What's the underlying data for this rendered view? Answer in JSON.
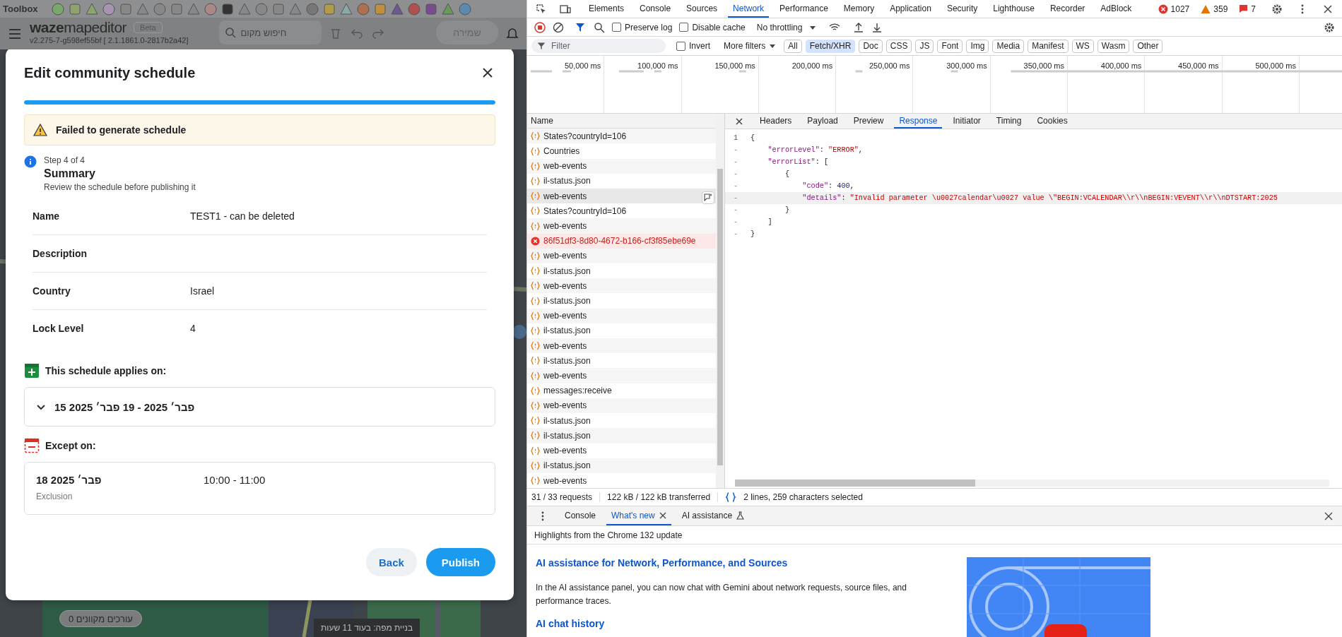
{
  "app": {
    "toolbox_label": "Toolbox",
    "logo_bold": "waze",
    "logo_light": "mapeditor",
    "beta": "Beta",
    "version": "v2.275-7-g598ef55bf [ 2.1.1861.0-2817b2a42]",
    "search": {
      "placeholder": "חיפוש מקום"
    },
    "save_button": "שמירה",
    "online_editors": "עורכים מקוונים 0",
    "map_build": "בניית מפה: בעוד 11 שעות"
  },
  "dialog": {
    "title": "Edit community schedule",
    "progress": {
      "level": 1
    },
    "alert": "Failed to generate schedule",
    "step": {
      "counter": "Step 4 of 4",
      "title": "Summary",
      "description": "Review the schedule before publishing it"
    },
    "fields": [
      {
        "label": "Name",
        "value": "TEST1 - can be deleted"
      },
      {
        "label": "Description"
      },
      {
        "label": "Country",
        "value": "Israel"
      },
      {
        "label": "Lock Level",
        "value": "4"
      }
    ],
    "applies_heading": "This schedule applies on:",
    "applies_range": {
      "text": "פבר׳ 2025 - 19 פבר׳ 2025 15",
      "expanded": false
    },
    "except_heading": "Except on:",
    "exceptions": [
      {
        "date": "פבר׳ 2025 18",
        "type": "Exclusion",
        "time": "10:00 - 11:00"
      }
    ],
    "buttons": [
      {
        "label": "Back",
        "kind": "secondary"
      },
      {
        "label": "Publish",
        "kind": "primary"
      }
    ]
  },
  "devtools": {
    "tabs": [
      {
        "label": "Elements",
        "selected": false
      },
      {
        "label": "Console",
        "selected": false
      },
      {
        "label": "Sources",
        "selected": false
      },
      {
        "label": "Network",
        "selected": true
      },
      {
        "label": "Performance",
        "selected": false
      },
      {
        "label": "Memory",
        "selected": false
      },
      {
        "label": "Application",
        "selected": false
      },
      {
        "label": "Security",
        "selected": false
      },
      {
        "label": "Lighthouse",
        "selected": false
      },
      {
        "label": "Recorder",
        "selected": false
      },
      {
        "label": "AdBlock",
        "selected": false
      }
    ],
    "counts": {
      "errors": "1027",
      "warnings": "359",
      "issues": "7"
    },
    "toolbar": {
      "preserve_log": {
        "label": "Preserve log",
        "checked": false
      },
      "disable_cache": {
        "label": "Disable cache",
        "checked": false
      },
      "throttling": "No throttling"
    },
    "filter": {
      "placeholder": "Filter",
      "invert": {
        "label": "Invert",
        "checked": false
      },
      "more_filters": "More filters",
      "types": [
        {
          "label": "All",
          "selected": false
        },
        {
          "label": "Fetch/XHR",
          "selected": true
        },
        {
          "label": "Doc",
          "selected": false
        },
        {
          "label": "CSS",
          "selected": false
        },
        {
          "label": "JS",
          "selected": false
        },
        {
          "label": "Font",
          "selected": false
        },
        {
          "label": "Img",
          "selected": false
        },
        {
          "label": "Media",
          "selected": false
        },
        {
          "label": "Manifest",
          "selected": false
        },
        {
          "label": "WS",
          "selected": false
        },
        {
          "label": "Wasm",
          "selected": false
        },
        {
          "label": "Other",
          "selected": false
        }
      ]
    },
    "timeline_ticks": [
      "50,000 ms",
      "100,000 ms",
      "150,000 ms",
      "200,000 ms",
      "250,000 ms",
      "300,000 ms",
      "350,000 ms",
      "400,000 ms",
      "450,000 ms",
      "500,000 ms"
    ],
    "name_header": "Name",
    "requests": [
      {
        "name": "States?countryId=106",
        "kind": "xhr",
        "selected": false
      },
      {
        "name": "Countries",
        "kind": "xhr",
        "selected": false
      },
      {
        "name": "web-events",
        "kind": "xhr",
        "selected": false
      },
      {
        "name": "il-status.json",
        "kind": "xhr",
        "selected": false
      },
      {
        "name": "web-events",
        "kind": "xhr",
        "selected": true
      },
      {
        "name": "States?countryId=106",
        "kind": "xhr",
        "selected": false
      },
      {
        "name": "web-events",
        "kind": "xhr",
        "selected": false
      },
      {
        "name": "86f51df3-8d80-4672-b166-cf3f85ebe69e",
        "kind": "error",
        "selected": false
      },
      {
        "name": "web-events",
        "kind": "xhr",
        "selected": false
      },
      {
        "name": "il-status.json",
        "kind": "xhr",
        "selected": false
      },
      {
        "name": "web-events",
        "kind": "xhr",
        "selected": false
      },
      {
        "name": "il-status.json",
        "kind": "xhr",
        "selected": false
      },
      {
        "name": "web-events",
        "kind": "xhr",
        "selected": false
      },
      {
        "name": "il-status.json",
        "kind": "xhr",
        "selected": false
      },
      {
        "name": "web-events",
        "kind": "xhr",
        "selected": false
      },
      {
        "name": "il-status.json",
        "kind": "xhr",
        "selected": false
      },
      {
        "name": "web-events",
        "kind": "xhr",
        "selected": false
      },
      {
        "name": "messages:receive",
        "kind": "xhr",
        "selected": false
      },
      {
        "name": "web-events",
        "kind": "xhr",
        "selected": false
      },
      {
        "name": "il-status.json",
        "kind": "xhr",
        "selected": false
      },
      {
        "name": "il-status.json",
        "kind": "xhr",
        "selected": false
      },
      {
        "name": "web-events",
        "kind": "xhr",
        "selected": false
      },
      {
        "name": "il-status.json",
        "kind": "xhr",
        "selected": false
      },
      {
        "name": "web-events",
        "kind": "xhr",
        "selected": false
      }
    ],
    "detail_tabs": [
      {
        "label": "Headers",
        "selected": false
      },
      {
        "label": "Payload",
        "selected": false
      },
      {
        "label": "Preview",
        "selected": false
      },
      {
        "label": "Response",
        "selected": true
      },
      {
        "label": "Initiator",
        "selected": false
      },
      {
        "label": "Timing",
        "selected": false
      },
      {
        "label": "Cookies",
        "selected": false
      }
    ],
    "code": [
      {
        "number": "1",
        "selected": false,
        "tokens": [
          {
            "kind": "punct",
            "text": "{"
          }
        ]
      },
      {
        "number": "-",
        "selected": false,
        "tokens": [
          {
            "kind": "key",
            "text": "    \"errorLevel\""
          },
          {
            "kind": "punct",
            "text": ": "
          },
          {
            "kind": "string",
            "text": "\"ERROR\""
          },
          {
            "kind": "punct",
            "text": ","
          }
        ]
      },
      {
        "number": "-",
        "selected": false,
        "tokens": [
          {
            "kind": "key",
            "text": "    \"errorList\""
          },
          {
            "kind": "punct",
            "text": ": ["
          }
        ]
      },
      {
        "number": "-",
        "selected": false,
        "tokens": [
          {
            "kind": "punct",
            "text": "        {"
          }
        ]
      },
      {
        "number": "-",
        "selected": false,
        "tokens": [
          {
            "kind": "key",
            "text": "            \"code\""
          },
          {
            "kind": "punct",
            "text": ": "
          },
          {
            "kind": "number",
            "text": "400"
          },
          {
            "kind": "punct",
            "text": ","
          }
        ]
      },
      {
        "number": "-",
        "selected": true,
        "tokens": [
          {
            "kind": "key",
            "text": "            \"details\""
          },
          {
            "kind": "punct",
            "text": ": "
          },
          {
            "kind": "string",
            "text": "\"Invalid parameter \\u0027calendar\\u0027 value \\\"BEGIN:VCALENDAR\\\\r\\\\nBEGIN:VEVENT\\\\r\\\\nDTSTART:2025"
          }
        ]
      },
      {
        "number": "-",
        "selected": false,
        "tokens": [
          {
            "kind": "punct",
            "text": "        }"
          }
        ]
      },
      {
        "number": "-",
        "selected": false,
        "tokens": [
          {
            "kind": "punct",
            "text": "    ]"
          }
        ]
      },
      {
        "number": "-",
        "selected": false,
        "tokens": [
          {
            "kind": "punct",
            "text": "}"
          }
        ]
      }
    ],
    "status": {
      "requests": "31 / 33 requests",
      "transferred": "122 kB / 122 kB transferred",
      "selection": "2 lines, 259 characters selected"
    },
    "drawer_tabs": [
      {
        "label": "Console",
        "selected": false,
        "kind": "plain"
      },
      {
        "label": "What's new",
        "selected": true,
        "kind": "closable"
      },
      {
        "label": "AI assistance",
        "selected": false,
        "kind": "experimental"
      }
    ],
    "whats_new": {
      "header": "Highlights from the Chrome 132 update",
      "sections": [
        {
          "title": "AI assistance for Network, Performance, and Sources",
          "body": "In the AI assistance panel, you can now chat with Gemini about network requests, source files, and performance traces."
        },
        {
          "title": "AI chat history"
        }
      ]
    }
  }
}
